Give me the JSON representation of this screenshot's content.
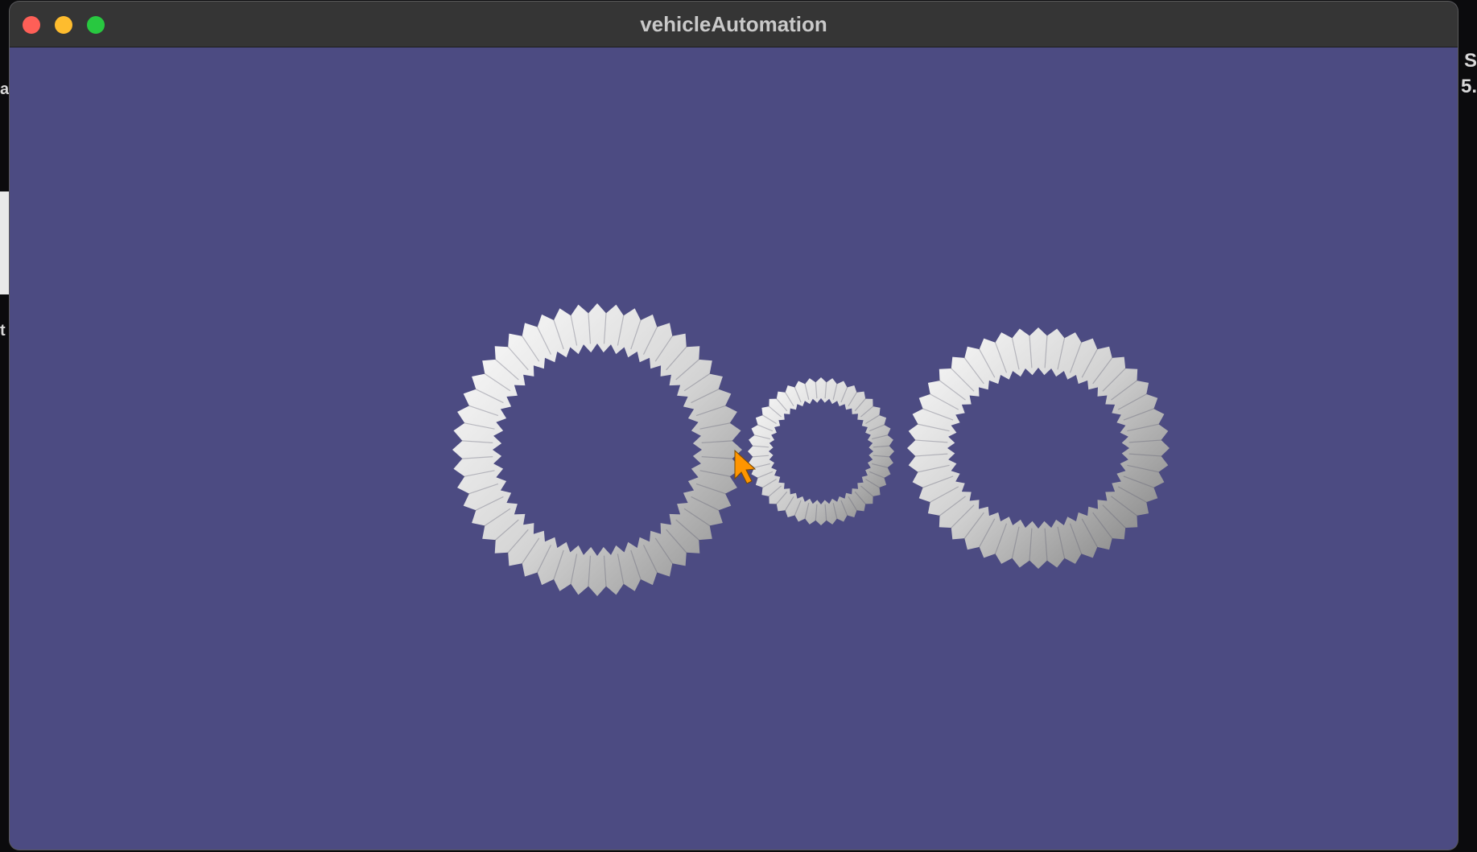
{
  "window": {
    "title": "vehicleAutomation"
  },
  "background_fragments": [
    "n S",
    "5.",
    "a",
    "t"
  ],
  "scene": {
    "background_color": "#4c4b82",
    "gears": [
      {
        "name": "large-left-gear-icon"
      },
      {
        "name": "small-middle-gear-icon"
      },
      {
        "name": "right-gear-icon"
      }
    ],
    "cursor_color": "#ff9500"
  }
}
